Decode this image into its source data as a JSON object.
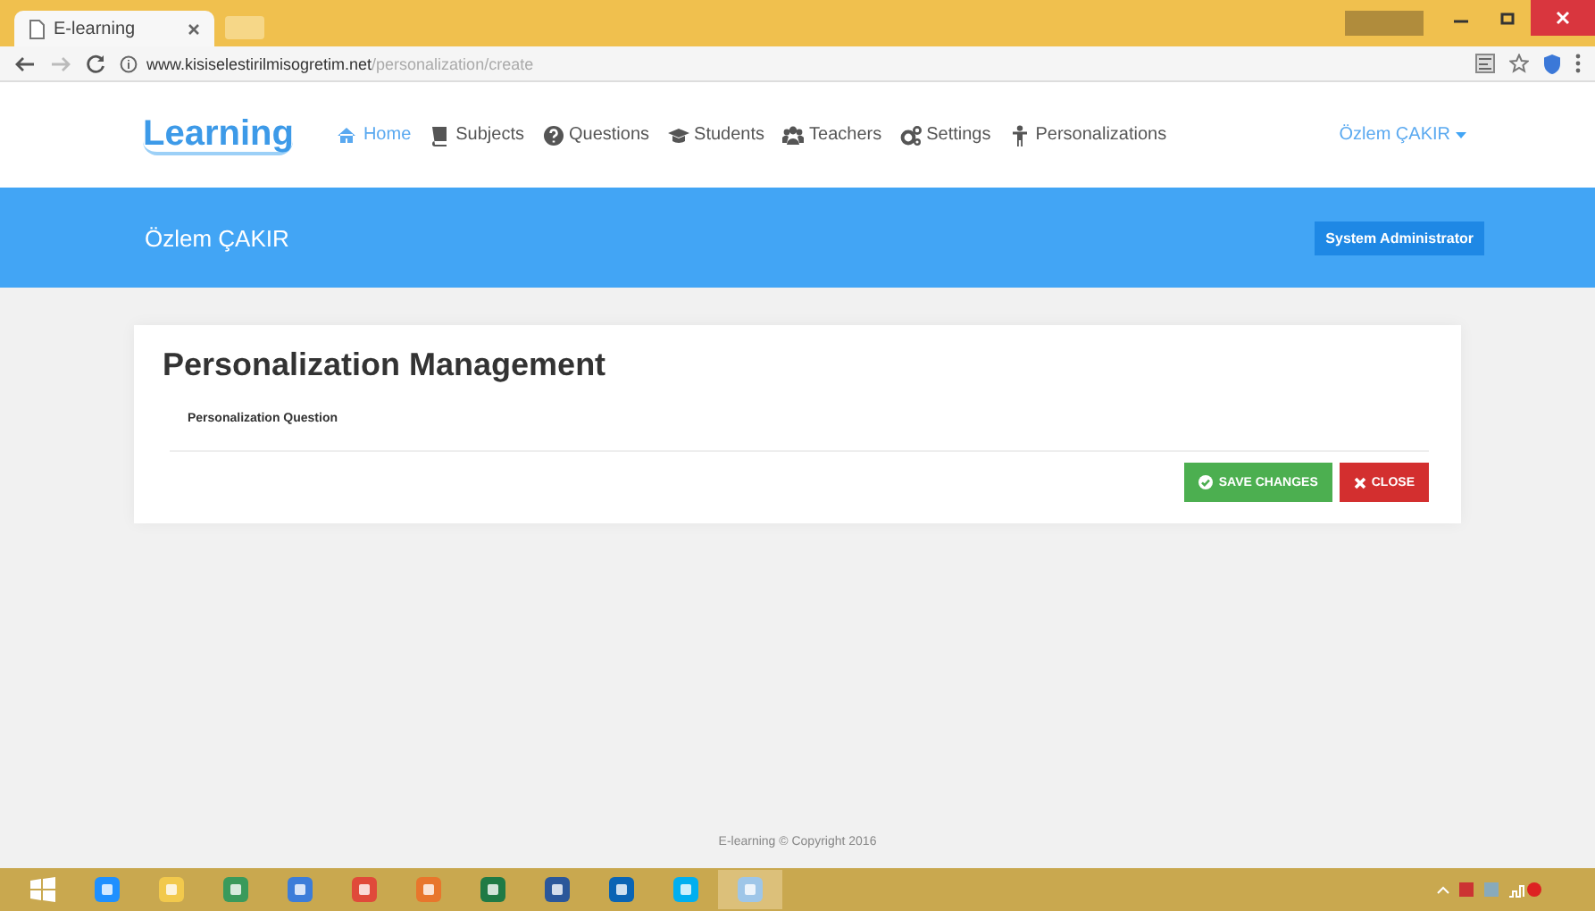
{
  "browser": {
    "tab_title": "E-learning",
    "url_domain": "www.kisiselestirilmisogretim.net",
    "url_path": "/personalization/create"
  },
  "navbar": {
    "brand": "Learning",
    "items": [
      {
        "label": "Home",
        "selected": true
      },
      {
        "label": "Subjects",
        "selected": false
      },
      {
        "label": "Questions",
        "selected": false
      },
      {
        "label": "Students",
        "selected": false
      },
      {
        "label": "Teachers",
        "selected": false
      },
      {
        "label": "Settings",
        "selected": false
      },
      {
        "label": "Personalizations",
        "selected": false
      }
    ],
    "user_menu": "Özlem ÇAKIR"
  },
  "banner": {
    "name": "Özlem ÇAKIR",
    "role": "System Administrator"
  },
  "card": {
    "title": "Personalization Management",
    "field_label": "Personalization Question",
    "buttons": [
      {
        "label": "SAVE CHANGES",
        "kind": "save"
      },
      {
        "label": "CLOSE",
        "kind": "close"
      }
    ]
  },
  "footer": "E-learning © Copyright 2016"
}
